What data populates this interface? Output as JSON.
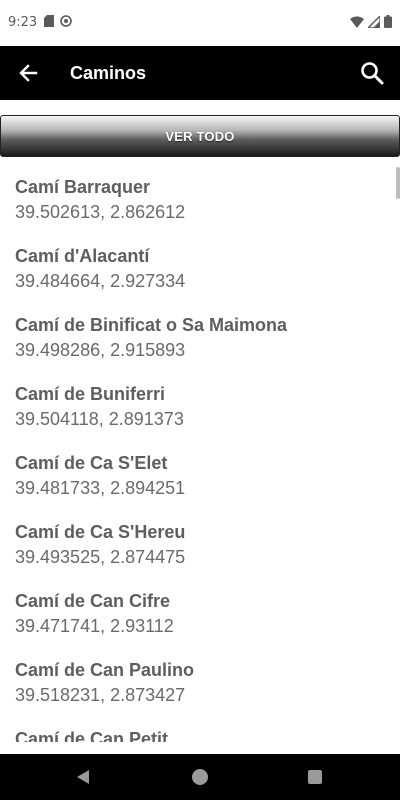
{
  "status_bar": {
    "time": "9:23",
    "icons": [
      "sd-card-icon",
      "sync-icon",
      "wifi-icon",
      "signal-icon",
      "battery-icon"
    ]
  },
  "app_bar": {
    "title": "Caminos",
    "back_icon": "arrow-back-icon",
    "search_icon": "search-icon",
    "background": "#000000"
  },
  "ver_todo_label": "VER TODO",
  "list": [
    {
      "name": "Camí Barraquer",
      "coords": "39.502613, 2.862612"
    },
    {
      "name": "Camí d'Alacantí",
      "coords": "39.484664, 2.927334"
    },
    {
      "name": "Camí de Binificat o Sa Maimona",
      "coords": "39.498286, 2.915893"
    },
    {
      "name": "Camí de Buniferri",
      "coords": "39.504118, 2.891373"
    },
    {
      "name": "Camí de Ca S'Elet",
      "coords": "39.481733, 2.894251"
    },
    {
      "name": "Camí de Ca S'Hereu",
      "coords": "39.493525, 2.874475"
    },
    {
      "name": "Camí de Can Cifre",
      "coords": "39.471741, 2.93112"
    },
    {
      "name": "Camí de Can Paulino",
      "coords": "39.518231, 2.873427"
    },
    {
      "name": "Camí de Can Petit",
      "coords": ""
    }
  ],
  "nav_bar": {
    "icons": [
      "nav-back-icon",
      "nav-home-icon",
      "nav-recents-icon"
    ]
  }
}
